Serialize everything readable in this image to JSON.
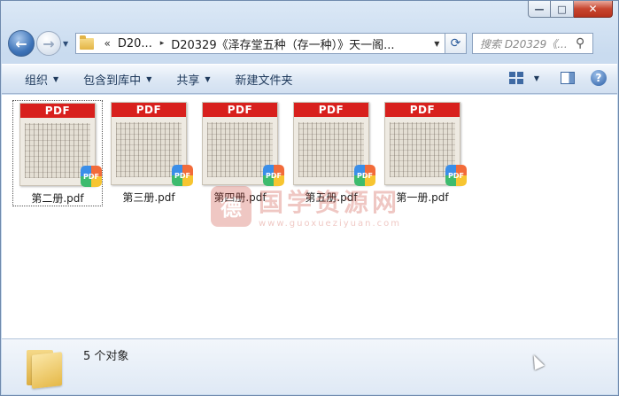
{
  "window": {
    "caption_buttons": {
      "minimize": "—",
      "maximize": "□",
      "close": "✕"
    }
  },
  "nav": {
    "back_icon": "←",
    "forward_icon": "→",
    "breadcrumb": {
      "overflow": "«",
      "item_1": "D20...",
      "separator": "▸",
      "item_2": "D20329《泽存堂五种（存一种）》天一阁..."
    },
    "refresh_icon": "⟳",
    "search_placeholder": "搜索 D20329《...",
    "search_icon": "⚲"
  },
  "toolbar": {
    "organize": "组织",
    "include_in_library": "包含到库中",
    "share": "共享",
    "new_folder": "新建文件夹",
    "help": "?"
  },
  "files": [
    {
      "name": "第二册.pdf",
      "header": "PDF",
      "badge": "PDF",
      "selected": true
    },
    {
      "name": "第三册.pdf",
      "header": "PDF",
      "badge": "PDF",
      "selected": false
    },
    {
      "name": "第四册.pdf",
      "header": "PDF",
      "badge": "PDF",
      "selected": false
    },
    {
      "name": "第五册.pdf",
      "header": "PDF",
      "badge": "PDF",
      "selected": false
    },
    {
      "name": "第一册.pdf",
      "header": "PDF",
      "badge": "PDF",
      "selected": false
    }
  ],
  "watermark": {
    "seal": "德",
    "text": "国学资源网",
    "url": "www.guoxueziyuan.com"
  },
  "details": {
    "count_text": "5 个对象"
  },
  "colors": {
    "pdf_red": "#d8201d",
    "accent_blue": "#3d73b8",
    "close_red": "#c7452f"
  }
}
